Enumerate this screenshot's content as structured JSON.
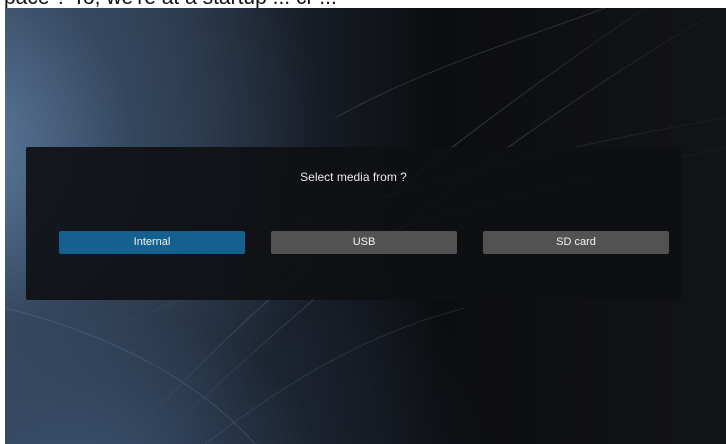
{
  "header_fragment": "pace ? To, we're at a startup ... cr ...",
  "dialog": {
    "title": "Select media from ?",
    "options": [
      {
        "label": "Internal",
        "selected": true
      },
      {
        "label": "USB",
        "selected": false
      },
      {
        "label": "SD card",
        "selected": false
      }
    ]
  },
  "colors": {
    "selected_button": "#14618f",
    "normal_button": "#525253",
    "dialog_background": "#0e0f13",
    "text": "#f2f2f2"
  }
}
